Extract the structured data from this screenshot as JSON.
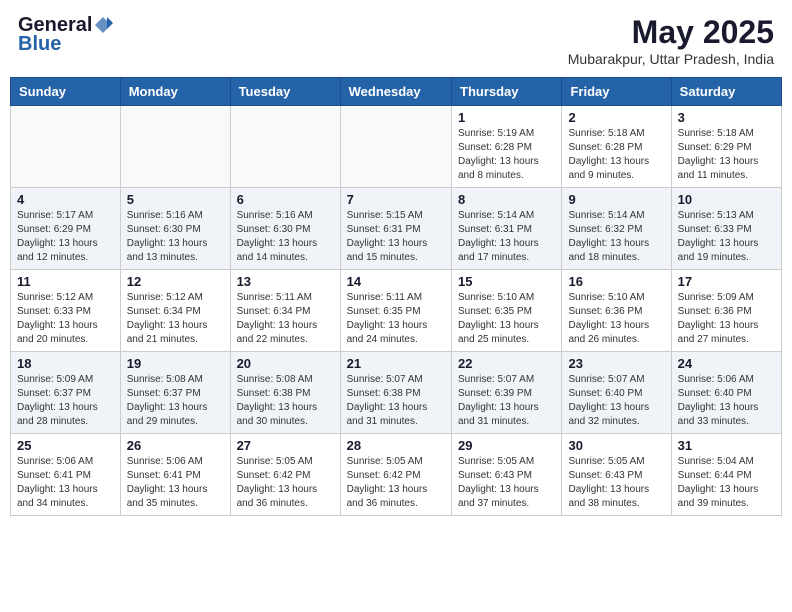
{
  "header": {
    "logo_general": "General",
    "logo_blue": "Blue",
    "month_year": "May 2025",
    "location": "Mubarakpur, Uttar Pradesh, India"
  },
  "days_of_week": [
    "Sunday",
    "Monday",
    "Tuesday",
    "Wednesday",
    "Thursday",
    "Friday",
    "Saturday"
  ],
  "weeks": [
    [
      {
        "day": "",
        "info": ""
      },
      {
        "day": "",
        "info": ""
      },
      {
        "day": "",
        "info": ""
      },
      {
        "day": "",
        "info": ""
      },
      {
        "day": "1",
        "info": "Sunrise: 5:19 AM\nSunset: 6:28 PM\nDaylight: 13 hours\nand 8 minutes."
      },
      {
        "day": "2",
        "info": "Sunrise: 5:18 AM\nSunset: 6:28 PM\nDaylight: 13 hours\nand 9 minutes."
      },
      {
        "day": "3",
        "info": "Sunrise: 5:18 AM\nSunset: 6:29 PM\nDaylight: 13 hours\nand 11 minutes."
      }
    ],
    [
      {
        "day": "4",
        "info": "Sunrise: 5:17 AM\nSunset: 6:29 PM\nDaylight: 13 hours\nand 12 minutes."
      },
      {
        "day": "5",
        "info": "Sunrise: 5:16 AM\nSunset: 6:30 PM\nDaylight: 13 hours\nand 13 minutes."
      },
      {
        "day": "6",
        "info": "Sunrise: 5:16 AM\nSunset: 6:30 PM\nDaylight: 13 hours\nand 14 minutes."
      },
      {
        "day": "7",
        "info": "Sunrise: 5:15 AM\nSunset: 6:31 PM\nDaylight: 13 hours\nand 15 minutes."
      },
      {
        "day": "8",
        "info": "Sunrise: 5:14 AM\nSunset: 6:31 PM\nDaylight: 13 hours\nand 17 minutes."
      },
      {
        "day": "9",
        "info": "Sunrise: 5:14 AM\nSunset: 6:32 PM\nDaylight: 13 hours\nand 18 minutes."
      },
      {
        "day": "10",
        "info": "Sunrise: 5:13 AM\nSunset: 6:33 PM\nDaylight: 13 hours\nand 19 minutes."
      }
    ],
    [
      {
        "day": "11",
        "info": "Sunrise: 5:12 AM\nSunset: 6:33 PM\nDaylight: 13 hours\nand 20 minutes."
      },
      {
        "day": "12",
        "info": "Sunrise: 5:12 AM\nSunset: 6:34 PM\nDaylight: 13 hours\nand 21 minutes."
      },
      {
        "day": "13",
        "info": "Sunrise: 5:11 AM\nSunset: 6:34 PM\nDaylight: 13 hours\nand 22 minutes."
      },
      {
        "day": "14",
        "info": "Sunrise: 5:11 AM\nSunset: 6:35 PM\nDaylight: 13 hours\nand 24 minutes."
      },
      {
        "day": "15",
        "info": "Sunrise: 5:10 AM\nSunset: 6:35 PM\nDaylight: 13 hours\nand 25 minutes."
      },
      {
        "day": "16",
        "info": "Sunrise: 5:10 AM\nSunset: 6:36 PM\nDaylight: 13 hours\nand 26 minutes."
      },
      {
        "day": "17",
        "info": "Sunrise: 5:09 AM\nSunset: 6:36 PM\nDaylight: 13 hours\nand 27 minutes."
      }
    ],
    [
      {
        "day": "18",
        "info": "Sunrise: 5:09 AM\nSunset: 6:37 PM\nDaylight: 13 hours\nand 28 minutes."
      },
      {
        "day": "19",
        "info": "Sunrise: 5:08 AM\nSunset: 6:37 PM\nDaylight: 13 hours\nand 29 minutes."
      },
      {
        "day": "20",
        "info": "Sunrise: 5:08 AM\nSunset: 6:38 PM\nDaylight: 13 hours\nand 30 minutes."
      },
      {
        "day": "21",
        "info": "Sunrise: 5:07 AM\nSunset: 6:38 PM\nDaylight: 13 hours\nand 31 minutes."
      },
      {
        "day": "22",
        "info": "Sunrise: 5:07 AM\nSunset: 6:39 PM\nDaylight: 13 hours\nand 31 minutes."
      },
      {
        "day": "23",
        "info": "Sunrise: 5:07 AM\nSunset: 6:40 PM\nDaylight: 13 hours\nand 32 minutes."
      },
      {
        "day": "24",
        "info": "Sunrise: 5:06 AM\nSunset: 6:40 PM\nDaylight: 13 hours\nand 33 minutes."
      }
    ],
    [
      {
        "day": "25",
        "info": "Sunrise: 5:06 AM\nSunset: 6:41 PM\nDaylight: 13 hours\nand 34 minutes."
      },
      {
        "day": "26",
        "info": "Sunrise: 5:06 AM\nSunset: 6:41 PM\nDaylight: 13 hours\nand 35 minutes."
      },
      {
        "day": "27",
        "info": "Sunrise: 5:05 AM\nSunset: 6:42 PM\nDaylight: 13 hours\nand 36 minutes."
      },
      {
        "day": "28",
        "info": "Sunrise: 5:05 AM\nSunset: 6:42 PM\nDaylight: 13 hours\nand 36 minutes."
      },
      {
        "day": "29",
        "info": "Sunrise: 5:05 AM\nSunset: 6:43 PM\nDaylight: 13 hours\nand 37 minutes."
      },
      {
        "day": "30",
        "info": "Sunrise: 5:05 AM\nSunset: 6:43 PM\nDaylight: 13 hours\nand 38 minutes."
      },
      {
        "day": "31",
        "info": "Sunrise: 5:04 AM\nSunset: 6:44 PM\nDaylight: 13 hours\nand 39 minutes."
      }
    ]
  ]
}
